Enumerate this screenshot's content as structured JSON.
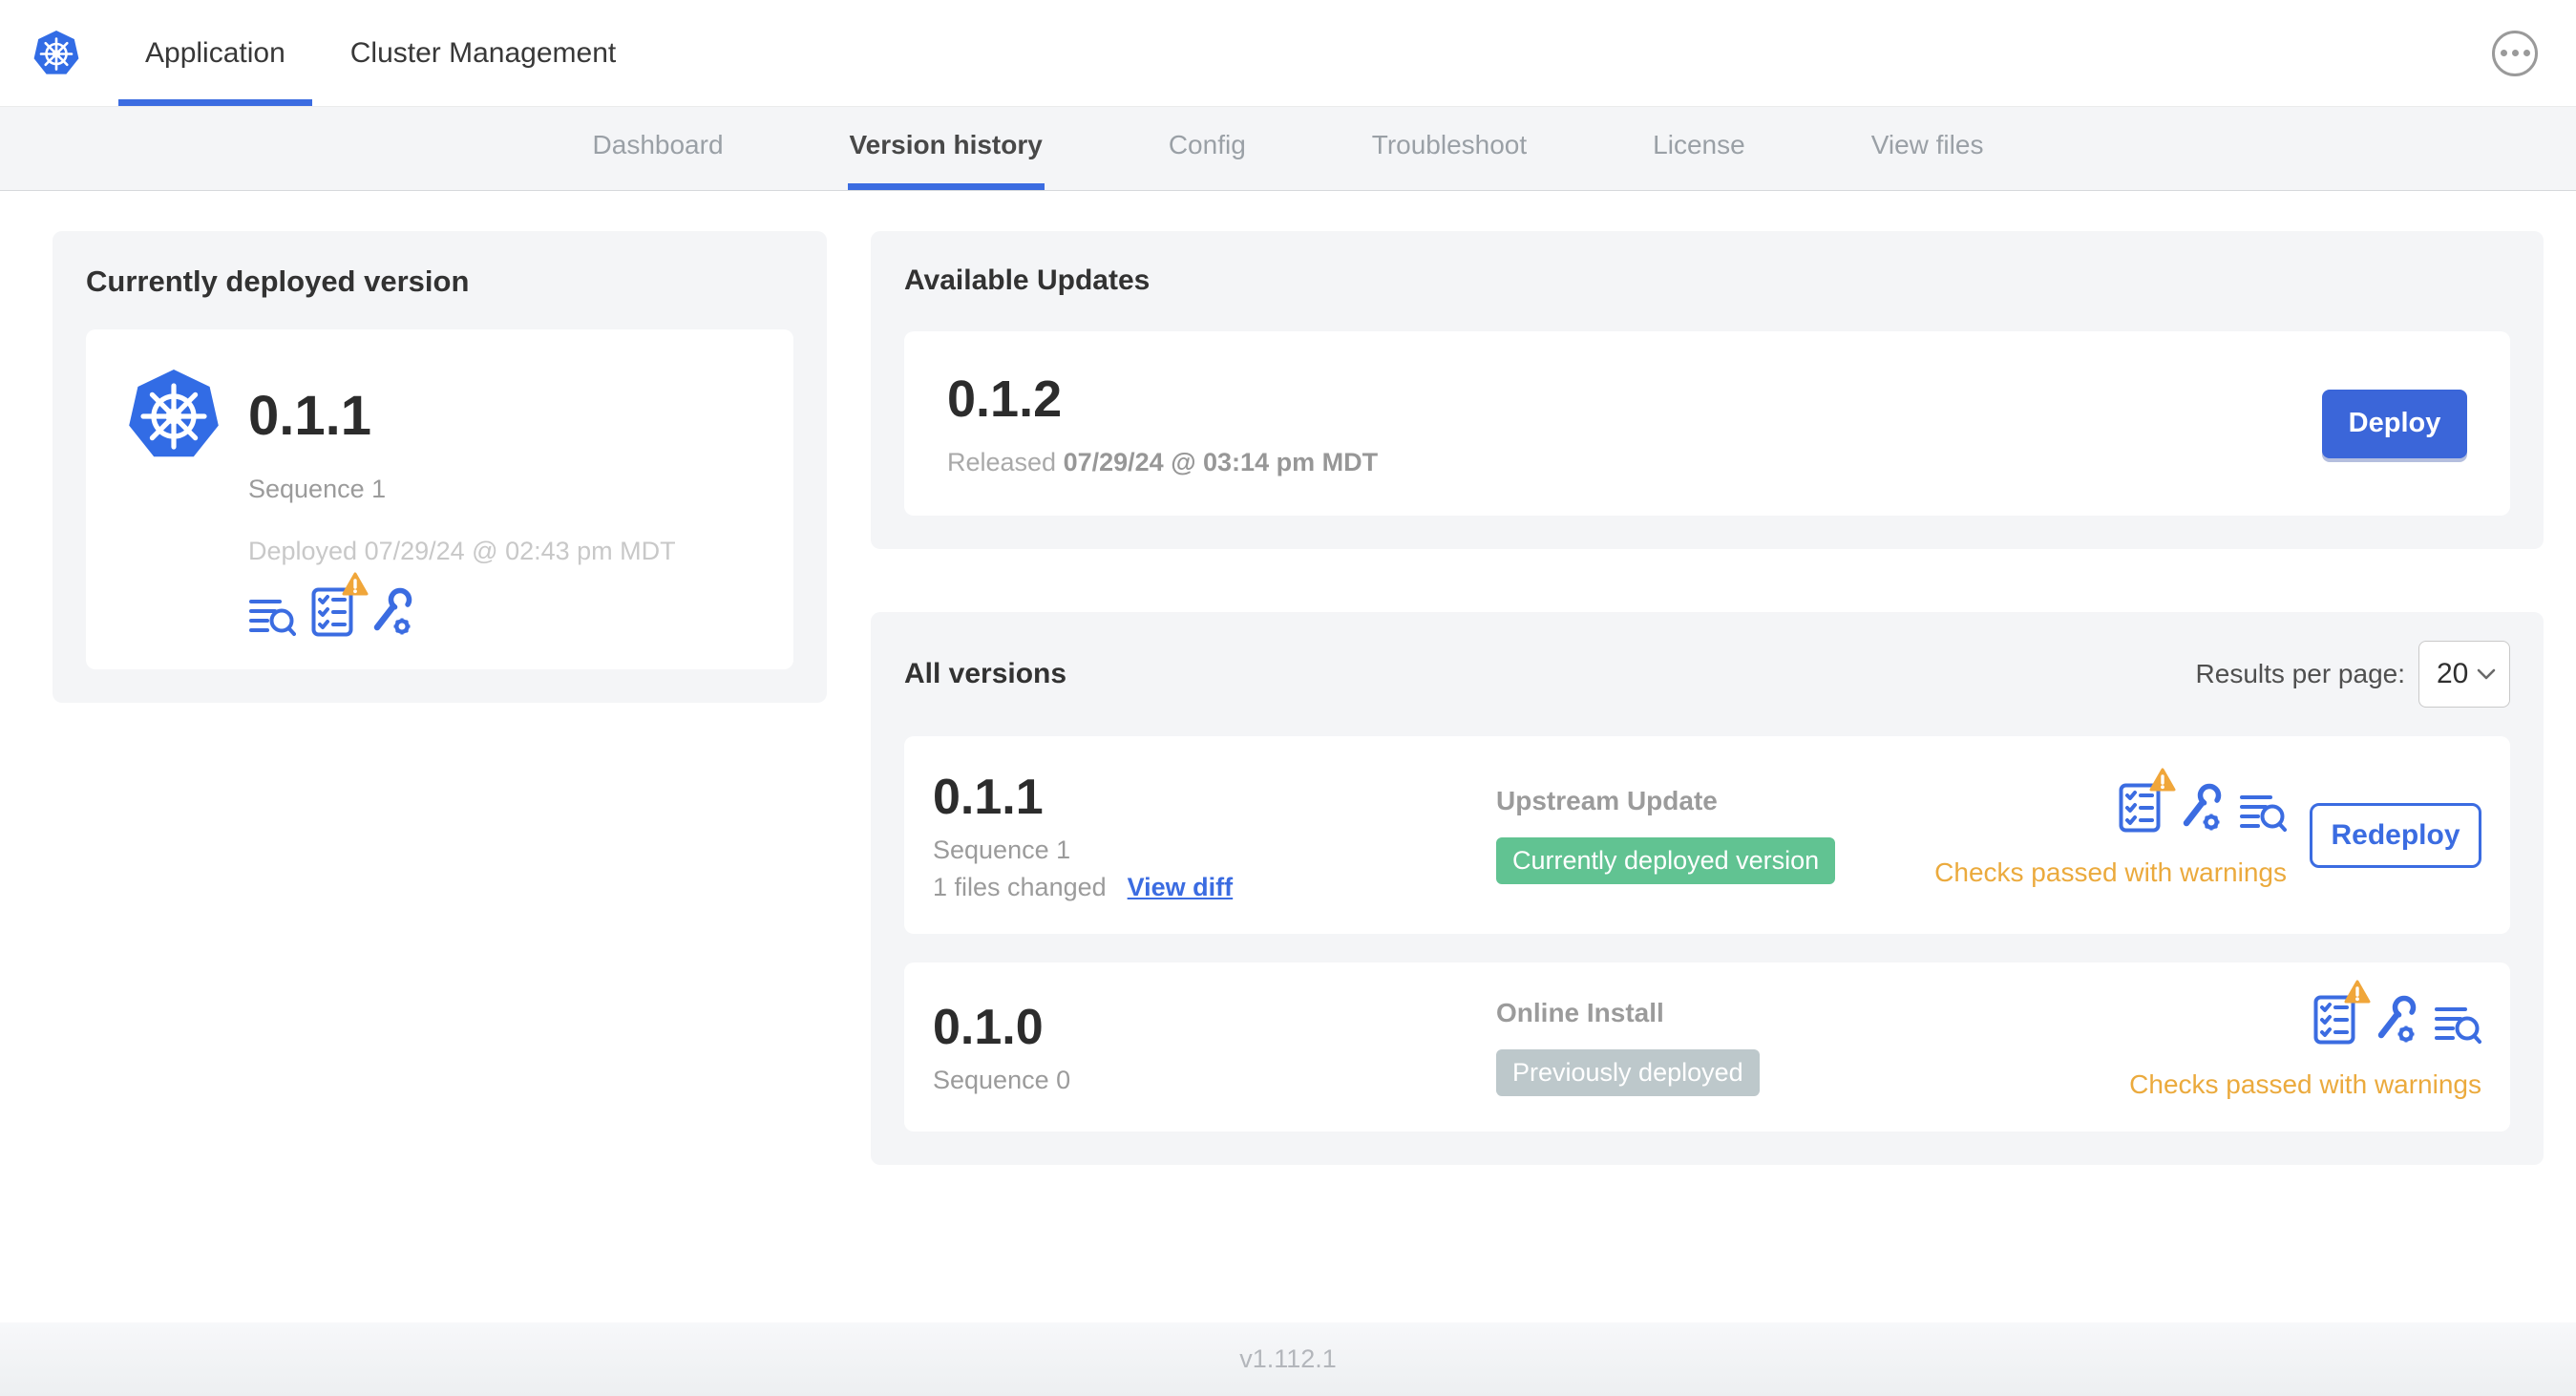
{
  "header": {
    "tabs": [
      {
        "label": "Application",
        "active": true
      },
      {
        "label": "Cluster Management",
        "active": false
      }
    ],
    "logo": "kubernetes-logo",
    "menu_icon": "ellipsis-menu-icon"
  },
  "subnav": {
    "tabs": [
      {
        "label": "Dashboard",
        "active": false
      },
      {
        "label": "Version history",
        "active": true
      },
      {
        "label": "Config",
        "active": false
      },
      {
        "label": "Troubleshoot",
        "active": false
      },
      {
        "label": "License",
        "active": false
      },
      {
        "label": "View files",
        "active": false
      }
    ]
  },
  "current_version_card": {
    "title": "Currently deployed version",
    "version": "0.1.1",
    "sequence": "Sequence 1",
    "deployed": "Deployed 07/29/24 @ 02:43 pm MDT",
    "icons": [
      "logs-icon",
      "preflight-checks-warning-icon",
      "config-tools-icon"
    ]
  },
  "available_updates": {
    "title": "Available Updates",
    "version": "0.1.2",
    "released_prefix": "Released",
    "released_date": "07/29/24 @ 03:14 pm MDT",
    "deploy_label": "Deploy"
  },
  "all_versions": {
    "title": "All versions",
    "results_per_page_label": "Results per page:",
    "results_per_page_value": "20",
    "rows": [
      {
        "version": "0.1.1",
        "sequence": "Sequence 1",
        "files_changed": "1 files changed",
        "view_diff_label": "View diff",
        "source": "Upstream Update",
        "badge": "Currently deployed version",
        "badge_type": "green",
        "status": "Checks passed with warnings",
        "action_label": "Redeploy",
        "icons": [
          "preflight-checks-warning-icon",
          "config-tools-icon",
          "logs-icon"
        ]
      },
      {
        "version": "0.1.0",
        "sequence": "Sequence 0",
        "source": "Online Install",
        "badge": "Previously deployed",
        "badge_type": "gray",
        "status": "Checks passed with warnings",
        "icons": [
          "preflight-checks-warning-icon",
          "config-tools-icon",
          "logs-icon"
        ]
      }
    ]
  },
  "footer": {
    "version": "v1.112.1"
  },
  "colors": {
    "accent_blue": "#3b6ce1",
    "logo_blue": "#326ce5",
    "warning_amber": "#ebaa3d",
    "badge_green": "#61c392",
    "badge_gray": "#bdc8cb",
    "card_bg": "#f4f5f7"
  }
}
